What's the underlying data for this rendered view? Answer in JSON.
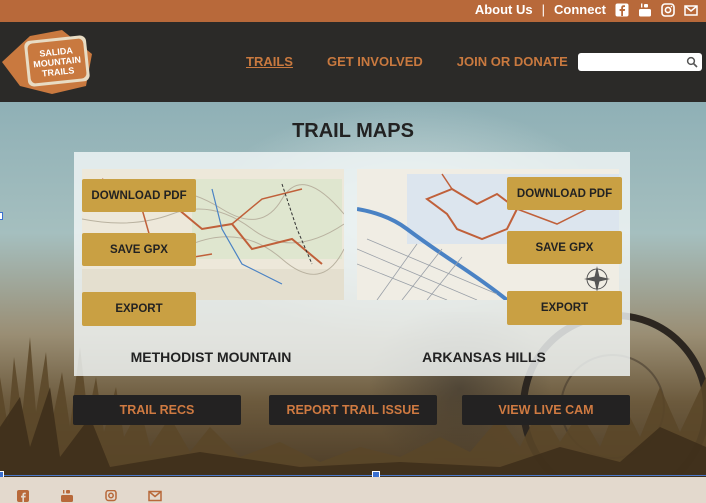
{
  "topbar": {
    "about": "About Us",
    "separator": "|",
    "connect": "Connect"
  },
  "logo": {
    "line1": "SALIDA",
    "line2": "MOUNTAIN",
    "line3": "TRAILS"
  },
  "nav": {
    "trails": "TRAILS",
    "get_involved": "GET INVOLVED",
    "join": "JOIN OR DONATE"
  },
  "search": {
    "placeholder": ""
  },
  "main": {
    "title": "TRAIL MAPS",
    "maps": [
      {
        "name": "METHODIST MOUNTAIN",
        "download": "DOWNLOAD PDF",
        "gpx": "SAVE GPX",
        "export": "EXPORT"
      },
      {
        "name": "ARKANSAS HILLS",
        "download": "DOWNLOAD PDF",
        "gpx": "SAVE GPX",
        "export": "EXPORT"
      }
    ],
    "actions": {
      "recs": "TRAIL RECS",
      "report": "REPORT TRAIL ISSUE",
      "cam": "VIEW LIVE CAM"
    }
  },
  "colors": {
    "accent": "#c9793f",
    "topbar": "#b8693a",
    "button": "#c9a043",
    "dark": "#232222"
  },
  "icons": [
    "facebook-icon",
    "youtube-icon",
    "instagram-icon",
    "mail-icon",
    "search-icon"
  ]
}
